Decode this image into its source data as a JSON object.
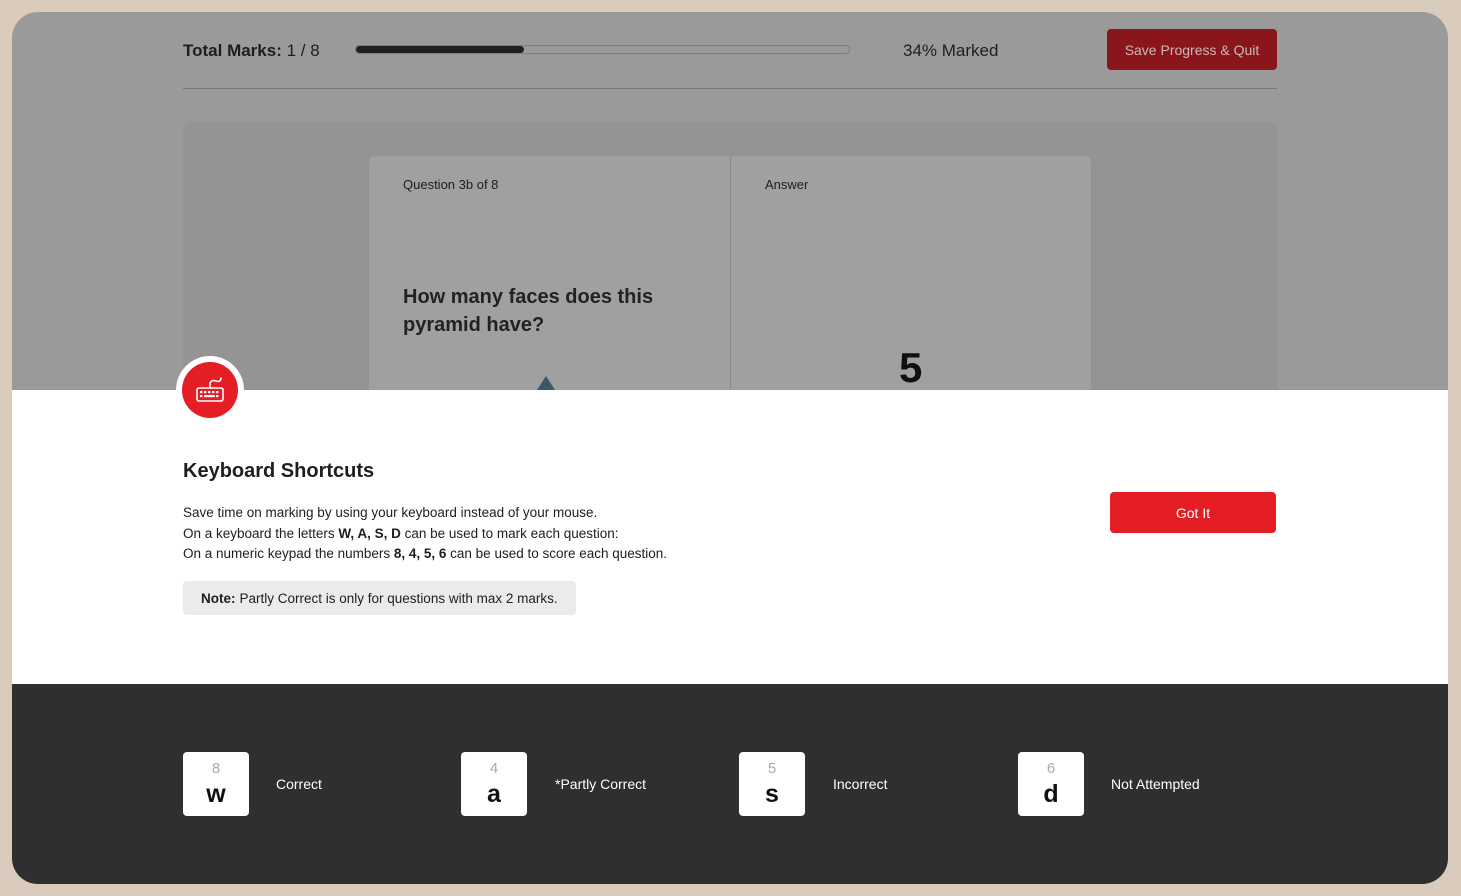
{
  "header": {
    "total_label": "Total Marks:",
    "total_value": "1 / 8",
    "progress_pct": 34,
    "marked_text": "34% Marked",
    "save_quit_label": "Save Progress & Quit"
  },
  "question": {
    "heading": "Question 3b of 8",
    "answer_heading": "Answer",
    "text": "How many faces does this pyramid have?",
    "answer_value": "5"
  },
  "modal": {
    "icon": "keyboard-icon",
    "title": "Keyboard Shortcuts",
    "line1": "Save time on marking by using your keyboard instead of your mouse.",
    "line2_pre": "On a keyboard the letters ",
    "line2_bold": "W, A, S, D",
    "line2_post": " can be used to mark each question:",
    "line3_pre": "On a numeric keypad the numbers ",
    "line3_bold": "8, 4, 5, 6",
    "line3_post": " can be used to score each question.",
    "note_label": "Note:",
    "note_text": "Partly Correct is only for questions with max 2 marks.",
    "got_it_label": "Got It"
  },
  "shortcuts": [
    {
      "num": "8",
      "letter": "w",
      "label": "Correct"
    },
    {
      "num": "4",
      "letter": "a",
      "label": "*Partly Correct"
    },
    {
      "num": "5",
      "letter": "s",
      "label": "Incorrect"
    },
    {
      "num": "6",
      "letter": "d",
      "label": "Not Attempted"
    }
  ],
  "colors": {
    "accent": "#e51e26",
    "accent_dim": "#8a161c",
    "footer_bg": "#2f2f2f",
    "frame": "#d9ccbc"
  }
}
